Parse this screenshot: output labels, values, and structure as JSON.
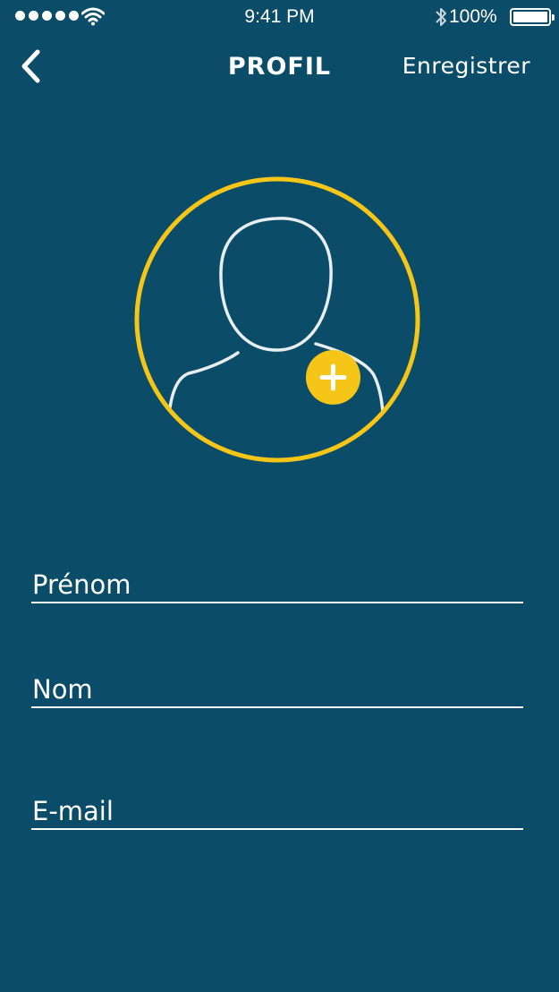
{
  "status_bar": {
    "time": "9:41 PM",
    "battery_percent": "100%",
    "signal_icon": "signal-dots-icon",
    "wifi_icon": "wifi-icon",
    "bluetooth_icon": "bluetooth-icon",
    "battery_icon": "battery-icon"
  },
  "nav": {
    "back_icon": "chevron-left-icon",
    "title": "PROFIL",
    "save_label": "Enregistrer"
  },
  "avatar": {
    "icon": "user-silhouette-icon",
    "add_icon": "plus-icon",
    "ring_color": "#f5c518",
    "add_button_color": "#f5c518"
  },
  "form": {
    "first_name": {
      "placeholder": "Prénom",
      "value": ""
    },
    "last_name": {
      "placeholder": "Nom",
      "value": ""
    },
    "email": {
      "placeholder": "E-mail",
      "value": ""
    }
  },
  "colors": {
    "background": "#0b4d68",
    "text": "#ffffff",
    "accent": "#f5c518"
  }
}
